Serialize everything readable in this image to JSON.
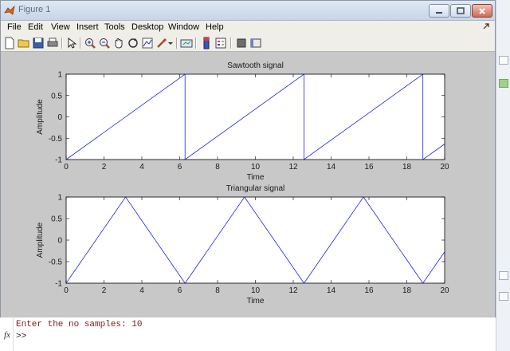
{
  "window": {
    "title": "Figure 1",
    "controls": [
      "minimize-icon",
      "maximize-icon",
      "close-icon"
    ]
  },
  "menu": [
    "File",
    "Edit",
    "View",
    "Insert",
    "Tools",
    "Desktop",
    "Window",
    "Help"
  ],
  "toolbar_icons": [
    "new-figure-icon",
    "open-file-icon",
    "save-icon",
    "print-icon",
    "edit-plot-icon",
    "zoom-in-icon",
    "zoom-out-icon",
    "pan-icon",
    "rotate-3d-icon",
    "data-cursor-icon",
    "brush-icon",
    "link-plot-icon",
    "colorbar-icon",
    "legend-icon",
    "hide-plot-tools-icon",
    "show-plot-tools-icon"
  ],
  "colors": {
    "line": "#2222ee",
    "plot_bg": "#c8c8c8",
    "axes_bg": "#ffffff"
  },
  "chart_data": [
    {
      "type": "line",
      "title": "Sawtooth signal",
      "xlabel": "Time",
      "ylabel": "Amplitude",
      "xlim": [
        0,
        20
      ],
      "ylim": [
        -1,
        1
      ],
      "xticks": [
        0,
        2,
        4,
        6,
        8,
        10,
        12,
        14,
        16,
        18,
        20
      ],
      "yticks": [
        1,
        0.5,
        0,
        -0.5,
        -1
      ],
      "x": [
        0,
        6.283,
        6.283,
        12.566,
        12.566,
        18.85,
        18.85,
        20
      ],
      "y": [
        -1,
        1,
        -1,
        1,
        -1,
        1,
        -1,
        -0.635
      ]
    },
    {
      "type": "line",
      "title": "Triangular signal",
      "xlabel": "Time",
      "ylabel": "Amplitude",
      "xlim": [
        0,
        20
      ],
      "ylim": [
        -1,
        1
      ],
      "xticks": [
        0,
        2,
        4,
        6,
        8,
        10,
        12,
        14,
        16,
        18,
        20
      ],
      "yticks": [
        1,
        0.5,
        0,
        -0.5,
        -1
      ],
      "x": [
        0,
        3.1416,
        6.2832,
        9.4248,
        12.5664,
        15.708,
        18.8496,
        20
      ],
      "y": [
        -1,
        1,
        -1,
        1,
        -1,
        1,
        -1,
        -0.27
      ]
    }
  ],
  "command_window": {
    "output": "Enter the no samples: 10",
    "prompt": ">>",
    "fx_label": "fx"
  }
}
